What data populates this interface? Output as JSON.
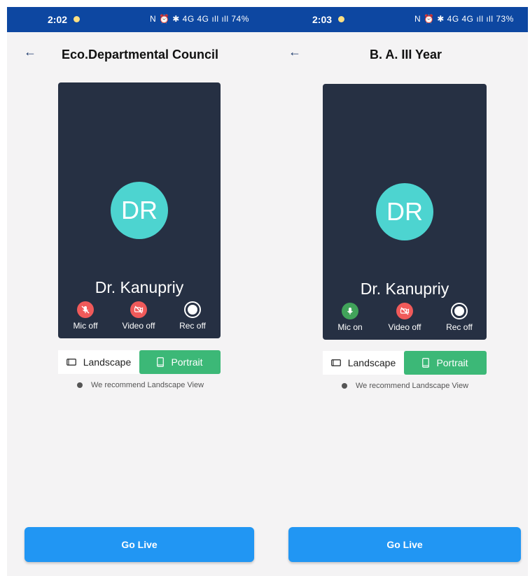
{
  "screens": [
    {
      "status": {
        "time": "2:02",
        "right": "N ⏰ ✱ 4G 4G ıll ıll 74%"
      },
      "title": "Eco.Departmental Council",
      "participant": {
        "initials": "DR",
        "name": "Dr. Kanupriy"
      },
      "controls": {
        "mic": "Mic off",
        "video": "Video off",
        "rec": "Rec off"
      },
      "mic_on": false,
      "orientation": {
        "landscape": "Landscape",
        "portrait": "Portrait",
        "selected": "Portrait"
      },
      "hint": "We recommend Landscape View",
      "go_live": "Go Live"
    },
    {
      "status": {
        "time": "2:03",
        "right": "N ⏰ ✱ 4G 4G ıll ıll 73%"
      },
      "title": "B. A. III Year",
      "participant": {
        "initials": "DR",
        "name": "Dr. Kanupriy"
      },
      "controls": {
        "mic": "Mic on",
        "video": "Video off",
        "rec": "Rec off"
      },
      "mic_on": true,
      "orientation": {
        "landscape": "Landscape",
        "portrait": "Portrait",
        "selected": "Portrait"
      },
      "hint": "We recommend Landscape View",
      "go_live": "Go Live"
    }
  ],
  "colors": {
    "status_bar": "#0d47a1",
    "card": "#263043",
    "avatar": "#4dd4d0",
    "mic_off": "#f05a5a",
    "mic_on": "#41a35a",
    "portrait_selected": "#3cb877",
    "go_live": "#2196f3"
  },
  "icons": [
    "back-arrow-icon",
    "mic-off-icon",
    "mic-on-icon",
    "video-off-icon",
    "record-icon",
    "landscape-icon",
    "portrait-icon"
  ]
}
